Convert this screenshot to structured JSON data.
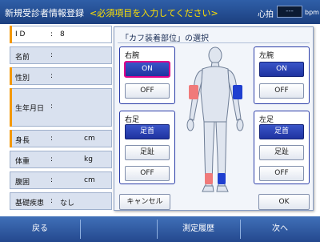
{
  "header": {
    "title": "新規受診者情報登録",
    "notice": "<必須項目を入力してください>",
    "pulse_label": "心拍",
    "pulse_value": "---",
    "pulse_unit": "bpm"
  },
  "form": {
    "rows": [
      {
        "label": "I D",
        "colon": ":",
        "value": "8",
        "unit": ""
      },
      {
        "label": "名前",
        "colon": ":",
        "value": "",
        "unit": ""
      },
      {
        "label": "性別",
        "colon": ":",
        "value": "",
        "unit": ""
      },
      {
        "label": "生年月日",
        "colon": ":",
        "value": "",
        "unit": ""
      },
      {
        "label": "身長",
        "colon": ":",
        "value": "",
        "unit": "cm"
      },
      {
        "label": "体重",
        "colon": ":",
        "value": "",
        "unit": "kg"
      },
      {
        "label": "腹囲",
        "colon": ":",
        "value": "",
        "unit": "cm"
      },
      {
        "label": "基礎疾患",
        "colon": ":",
        "value": "なし",
        "unit": ""
      }
    ]
  },
  "dialog": {
    "title": "「カフ装着部位」の選択",
    "right_arm": {
      "label": "右腕",
      "on": "ON",
      "off": "OFF"
    },
    "left_arm": {
      "label": "左腕",
      "on": "ON",
      "off": "OFF"
    },
    "right_leg": {
      "label": "右足",
      "ankle": "足首",
      "toe": "足趾",
      "off": "OFF"
    },
    "left_leg": {
      "label": "左足",
      "ankle": "足首",
      "toe": "足趾",
      "off": "OFF"
    },
    "cancel": "キャンセル",
    "ok": "OK"
  },
  "footer": {
    "back": "戻る",
    "history": "測定履歴",
    "next": "次へ"
  },
  "colors": {
    "header_bg": "#1c3f7f",
    "accent_on": "#1f33a0",
    "right_side_mark": "#f07a7a",
    "left_side_mark": "#1f3fd0",
    "highlight": "#e0008a"
  }
}
